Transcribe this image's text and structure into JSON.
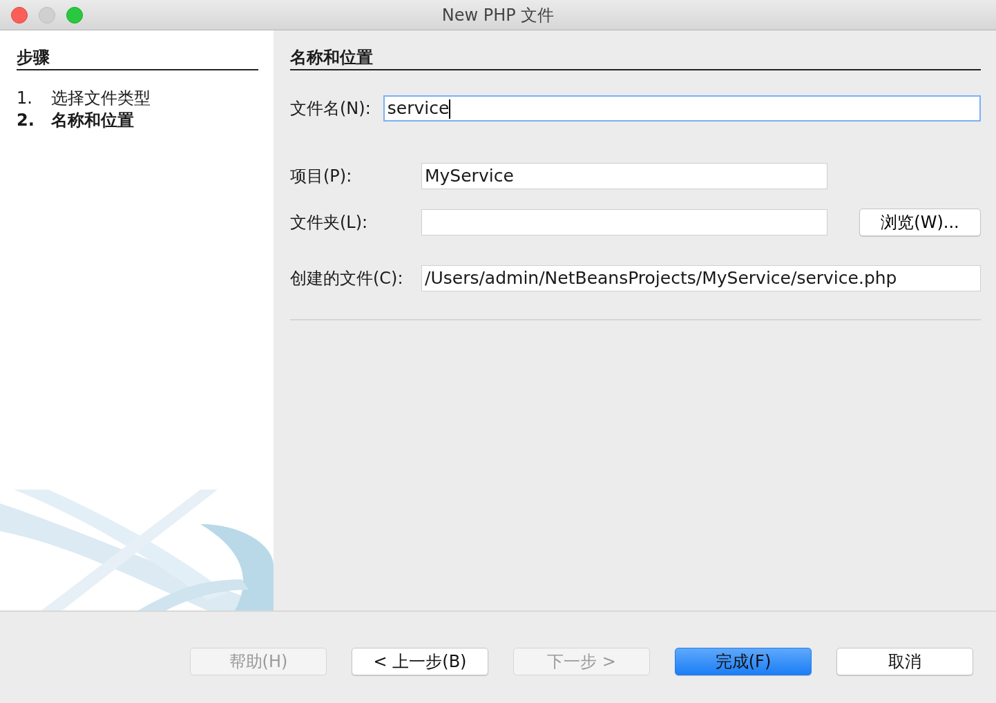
{
  "window": {
    "title": "New PHP 文件"
  },
  "steps": {
    "title": "步骤",
    "items": [
      {
        "number": "1.",
        "label": "选择文件类型",
        "selected": false
      },
      {
        "number": "2.",
        "label": "名称和位置",
        "selected": true
      }
    ]
  },
  "section_title": "名称和位置",
  "file_name": {
    "label": "文件名(N):",
    "value": "service",
    "focused": true
  },
  "fields": [
    {
      "label": "项目(P):",
      "value": "MyService",
      "focused": false
    },
    {
      "label": "文件夹(L):",
      "focused": false,
      "button": "浏览(W)..."
    },
    {
      "label": "创建的文件(C):",
      "value": "/Users/admin/NetBeansProjects/MyService/service.php",
      "focused": false
    }
  ],
  "buttons": [
    {
      "label": "帮助(H)",
      "disabled": true,
      "default": false
    },
    {
      "label": "< 上一步(B)",
      "disabled": false,
      "default": false
    },
    {
      "label": "下一步 >",
      "disabled": true,
      "default": false
    },
    {
      "label": "完成(F)",
      "disabled": false,
      "default": true
    },
    {
      "label": "取消",
      "disabled": false,
      "default": false
    }
  ]
}
